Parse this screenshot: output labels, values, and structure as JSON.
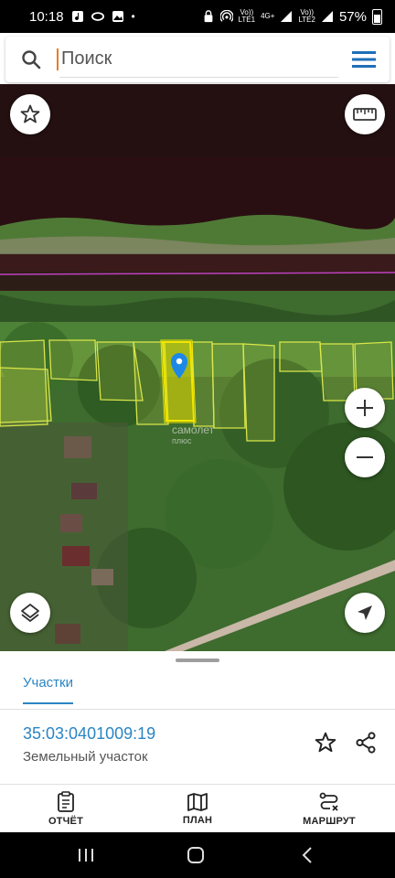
{
  "status_bar": {
    "time": "10:18",
    "dot": "•",
    "volte1": "Vo))",
    "lte1": "LTE1",
    "net": "4G+",
    "volte2": "Vo))",
    "lte2": "LTE2",
    "battery": "57%"
  },
  "search": {
    "placeholder": "Поиск"
  },
  "map": {
    "watermark_line1": "самолет",
    "watermark_line2": "плюс",
    "selected_parcel_color": "#f2e600",
    "parcel_color": "#d8e64a",
    "marker_color": "#1e88e5",
    "boundary_line_color": "#c040c0"
  },
  "sheet": {
    "tab_label": "Участки",
    "parcel_number": "35:03:0401009:19",
    "parcel_type": "Земельный участок"
  },
  "bottom_nav": {
    "report": "ОТЧЁТ",
    "plan": "ПЛАН",
    "route": "МАРШРУТ"
  },
  "colors": {
    "accent": "#2a85c4",
    "text": "#222222"
  }
}
